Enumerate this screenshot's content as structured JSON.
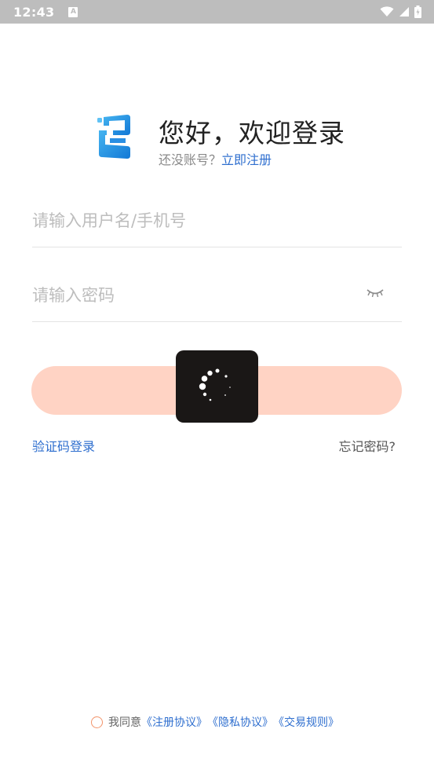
{
  "status_bar": {
    "time": "12:43",
    "notification_icon": "a-icon",
    "icons": [
      "wifi-icon",
      "signal-icon",
      "battery-charging-icon"
    ]
  },
  "header": {
    "greeting": "您好，欢迎登录",
    "no_account": "还没账号？",
    "register_link": "立即注册"
  },
  "form": {
    "username_placeholder": "请输入用户名/手机号",
    "password_placeholder": "请输入密码",
    "password_toggle_icon": "eye-closed-icon"
  },
  "login_button": {
    "label": "",
    "state": "loading"
  },
  "links": {
    "sms_login": "验证码登录",
    "forgot_password": "忘记密码?"
  },
  "agreement": {
    "checked": false,
    "prefix": "我同意",
    "register_terms": "《注册协议》",
    "privacy_terms": "《隐私协议》",
    "trade_rules": "《交易规则》"
  },
  "colors": {
    "accent": "#2f6fcf",
    "button_disabled": "#ffd3c4",
    "checkbox_border": "#f29268",
    "logo_blue": "#1b8fe0"
  }
}
